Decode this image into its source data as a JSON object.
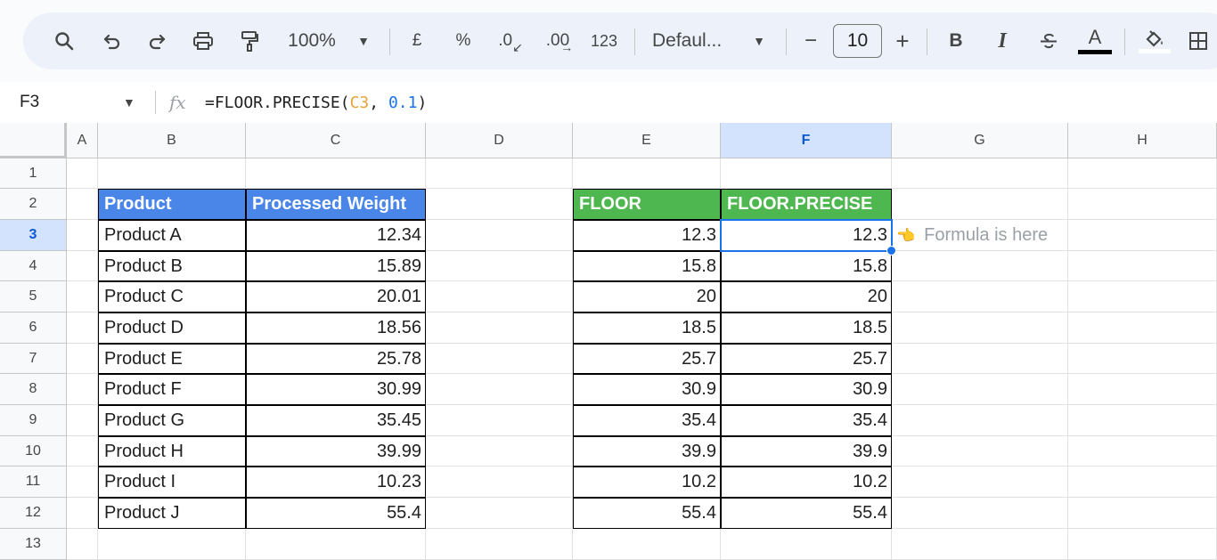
{
  "toolbar": {
    "zoom": "100%",
    "currency": "£",
    "percent": "%",
    "decimal_decrease": ".0",
    "decimal_increase": ".00",
    "number_format": "123",
    "font": "Defaul...",
    "font_size": "10",
    "bold": "B",
    "italic": "I",
    "text_color_letter": "A"
  },
  "formula_bar": {
    "cell_ref": "F3",
    "fx": "fx",
    "formula_prefix": "=FLOOR.PRECISE(",
    "formula_ref": "C3",
    "formula_sep": ", ",
    "formula_num": "0.1",
    "formula_suffix": ")"
  },
  "columns": [
    "A",
    "B",
    "C",
    "D",
    "E",
    "F",
    "G",
    "H"
  ],
  "rows": [
    "1",
    "2",
    "3",
    "4",
    "5",
    "6",
    "7",
    "8",
    "9",
    "10",
    "11",
    "12",
    "13"
  ],
  "selected_cell": {
    "column": "F",
    "row": "3"
  },
  "table1": {
    "headers": [
      "Product",
      "Processed Weight"
    ],
    "rows": [
      [
        "Product A",
        "12.34"
      ],
      [
        "Product B",
        "15.89"
      ],
      [
        "Product C",
        "20.01"
      ],
      [
        "Product D",
        "18.56"
      ],
      [
        "Product E",
        "25.78"
      ],
      [
        "Product F",
        "30.99"
      ],
      [
        "Product G",
        "35.45"
      ],
      [
        "Product H",
        "39.99"
      ],
      [
        "Product I",
        "10.23"
      ],
      [
        "Product J",
        "55.4"
      ]
    ]
  },
  "table2": {
    "headers": [
      "FLOOR",
      "FLOOR.PRECISE"
    ],
    "rows": [
      [
        "12.3",
        "12.3"
      ],
      [
        "15.8",
        "15.8"
      ],
      [
        "20",
        "20"
      ],
      [
        "18.5",
        "18.5"
      ],
      [
        "25.7",
        "25.7"
      ],
      [
        "30.9",
        "30.9"
      ],
      [
        "35.4",
        "35.4"
      ],
      [
        "39.9",
        "39.9"
      ],
      [
        "10.2",
        "10.2"
      ],
      [
        "55.4",
        "55.4"
      ]
    ]
  },
  "note": {
    "icon": "pointing-hand-icon",
    "text": "Formula is here"
  },
  "colors": {
    "blue_header": "#4a86e8",
    "green_header": "#4fb74f",
    "selection": "#1a73e8"
  }
}
